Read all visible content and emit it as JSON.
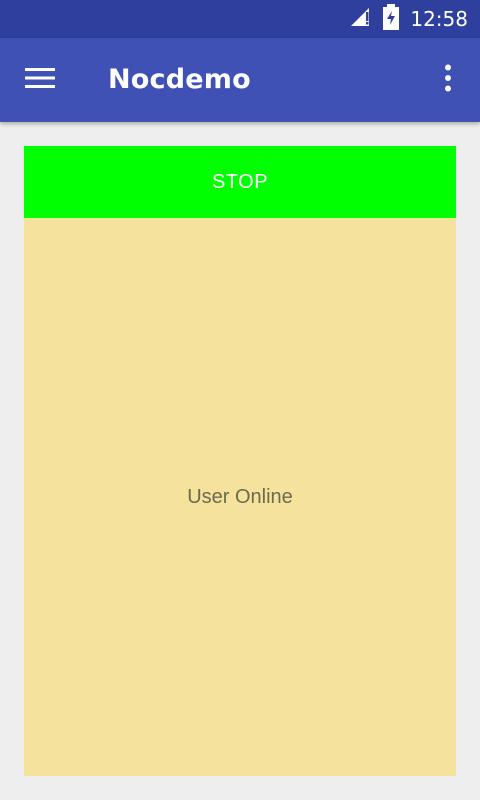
{
  "status_bar": {
    "time": "12:58",
    "icons": [
      "cellular-signal-alert-icon",
      "battery-charging-icon"
    ]
  },
  "app_bar": {
    "title": "Nocdemo",
    "left_icon": "menu-icon",
    "right_icon": "overflow-menu-icon",
    "background": "#3f51b5"
  },
  "main": {
    "stop_button_label": "STOP",
    "stop_button_color": "#00ff00",
    "panel_status_text": "User Online",
    "panel_color": "#f5e29c"
  }
}
